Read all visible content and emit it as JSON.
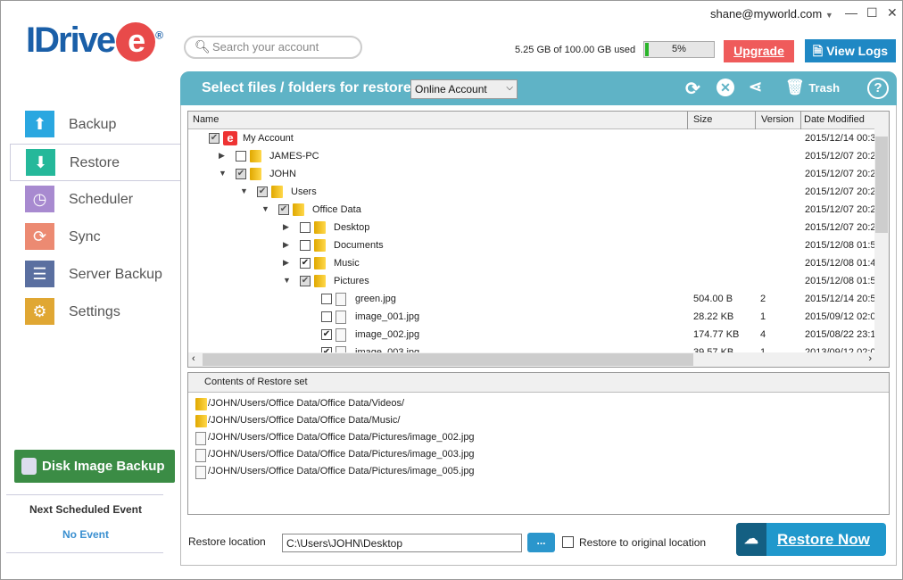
{
  "app": {
    "logo_text": "IDrive",
    "logo_e": "e",
    "logo_reg": "®"
  },
  "topbar": {
    "email": "shane@myworld.com",
    "minimize": "—",
    "maximize": "☐",
    "close": "✕"
  },
  "search": {
    "placeholder": "Search your account"
  },
  "usage": {
    "text": "5.25 GB of 100.00 GB used",
    "percent_label": "5%",
    "percent": 5,
    "color": "#2bb52b"
  },
  "buttons": {
    "upgrade": "Upgrade",
    "view_logs": "View Logs",
    "restore_now": "Restore Now",
    "browse": "...",
    "disk_image": "Disk Image Backup"
  },
  "sidebar": {
    "items": [
      {
        "label": "Backup",
        "icon": "upload-arrow-icon",
        "color": "#2aa7e0",
        "glyph": "⬆"
      },
      {
        "label": "Restore",
        "icon": "download-arrow-icon",
        "color": "#25b89a",
        "glyph": "⬇"
      },
      {
        "label": "Scheduler",
        "icon": "clock-icon",
        "color": "#a88ad0",
        "glyph": "◷"
      },
      {
        "label": "Sync",
        "icon": "sync-icon",
        "color": "#ec8a72",
        "glyph": "⟳"
      },
      {
        "label": "Server Backup",
        "icon": "server-icon",
        "color": "#5a6fa0",
        "glyph": "☰"
      },
      {
        "label": "Settings",
        "icon": "gear-icon",
        "color": "#e0a733",
        "glyph": "⚙"
      }
    ],
    "active": 1,
    "next_event_label": "Next Scheduled Event",
    "next_event_value": "No Event"
  },
  "panel": {
    "title": "Select files / folders for restore",
    "account_select": "Online Account",
    "trash": "Trash",
    "help": "?"
  },
  "tree": {
    "columns": [
      "Name",
      "Size",
      "Version",
      "Date Modified"
    ],
    "rows": [
      {
        "level": 0,
        "type": "account",
        "name": "My Account",
        "check": "partial",
        "exp": "",
        "size": "",
        "version": "",
        "date": "2015/12/14 00:3"
      },
      {
        "level": 1,
        "type": "folder",
        "name": "JAMES-PC",
        "check": "none",
        "exp": "▶",
        "size": "",
        "version": "",
        "date": "2015/12/07 20:2"
      },
      {
        "level": 1,
        "type": "folder",
        "name": "JOHN",
        "check": "partial",
        "exp": "▼",
        "size": "",
        "version": "",
        "date": "2015/12/07 20:2"
      },
      {
        "level": 2,
        "type": "folder",
        "name": "Users",
        "check": "partial",
        "exp": "▼",
        "size": "",
        "version": "",
        "date": "2015/12/07 20:2"
      },
      {
        "level": 3,
        "type": "folder",
        "name": "Office Data",
        "check": "partial",
        "exp": "▼",
        "size": "",
        "version": "",
        "date": "2015/12/07 20:2"
      },
      {
        "level": 4,
        "type": "folder",
        "name": "Desktop",
        "check": "none",
        "exp": "▶",
        "size": "",
        "version": "",
        "date": "2015/12/07 20:2"
      },
      {
        "level": 4,
        "type": "folder",
        "name": "Documents",
        "check": "none",
        "exp": "▶",
        "size": "",
        "version": "",
        "date": "2015/12/08 01:5"
      },
      {
        "level": 4,
        "type": "folder",
        "name": "Music",
        "check": "checked",
        "exp": "▶",
        "size": "",
        "version": "",
        "date": "2015/12/08 01:4"
      },
      {
        "level": 4,
        "type": "folder",
        "name": "Pictures",
        "check": "partial",
        "exp": "▼",
        "size": "",
        "version": "",
        "date": "2015/12/08 01:5"
      },
      {
        "level": 5,
        "type": "file",
        "name": "green.jpg",
        "check": "none",
        "exp": "",
        "size": "504.00 B",
        "version": "2",
        "date": "2015/12/14 20:5"
      },
      {
        "level": 5,
        "type": "file",
        "name": "image_001.jpg",
        "check": "none",
        "exp": "",
        "size": "28.22 KB",
        "version": "1",
        "date": "2015/09/12 02:0"
      },
      {
        "level": 5,
        "type": "file",
        "name": "image_002.jpg",
        "check": "checked",
        "exp": "",
        "size": "174.77 KB",
        "version": "4",
        "date": "2015/08/22 23:1"
      },
      {
        "level": 5,
        "type": "file",
        "name": "image_003.jpg",
        "check": "checked",
        "exp": "",
        "size": "39.57 KB",
        "version": "1",
        "date": "2013/09/12 02:0"
      }
    ]
  },
  "restore_set": {
    "header": "Contents of Restore set",
    "items": [
      {
        "type": "folder",
        "path": "/JOHN/Users/Office Data/Office Data/Videos/"
      },
      {
        "type": "folder",
        "path": "/JOHN/Users/Office Data/Office Data/Music/"
      },
      {
        "type": "file",
        "path": "/JOHN/Users/Office Data/Office Data/Pictures/image_002.jpg"
      },
      {
        "type": "file",
        "path": "/JOHN/Users/Office Data/Office Data/Pictures/image_003.jpg"
      },
      {
        "type": "file",
        "path": "/JOHN/Users/Office Data/Office Data/Pictures/image_005.jpg"
      }
    ]
  },
  "restore_location": {
    "label": "Restore location",
    "value": "C:\\Users\\JOHN\\Desktop",
    "original_label": "Restore to original location",
    "original_checked": false
  }
}
